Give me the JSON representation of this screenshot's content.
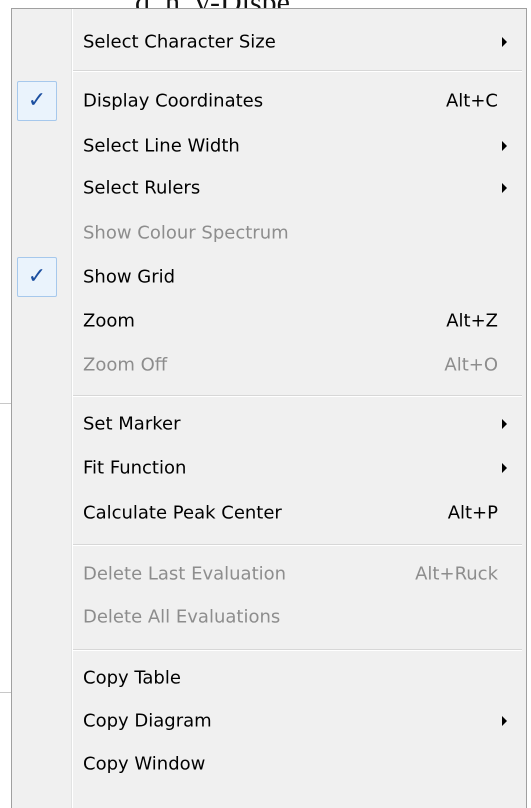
{
  "background_text": ", d. h. y-Dispe",
  "menu": {
    "items": [
      {
        "label": "Select Character Size",
        "shortcut": "",
        "submenu": true,
        "checked": false,
        "disabled": false
      },
      {
        "label": "Display Coordinates",
        "shortcut": "Alt+C",
        "submenu": false,
        "checked": true,
        "disabled": false
      },
      {
        "label": "Select Line Width",
        "shortcut": "",
        "submenu": true,
        "checked": false,
        "disabled": false
      },
      {
        "label": "Select Rulers",
        "shortcut": "",
        "submenu": true,
        "checked": false,
        "disabled": false
      },
      {
        "label": "Show Colour Spectrum",
        "shortcut": "",
        "submenu": false,
        "checked": false,
        "disabled": true
      },
      {
        "label": "Show Grid",
        "shortcut": "",
        "submenu": false,
        "checked": true,
        "disabled": false
      },
      {
        "label": "Zoom",
        "shortcut": "Alt+Z",
        "submenu": false,
        "checked": false,
        "disabled": false
      },
      {
        "label": "Zoom Off",
        "shortcut": "Alt+O",
        "submenu": false,
        "checked": false,
        "disabled": true
      },
      {
        "label": "Set Marker",
        "shortcut": "",
        "submenu": true,
        "checked": false,
        "disabled": false
      },
      {
        "label": "Fit Function",
        "shortcut": "",
        "submenu": true,
        "checked": false,
        "disabled": false
      },
      {
        "label": "Calculate Peak Center",
        "shortcut": "Alt+P",
        "submenu": false,
        "checked": false,
        "disabled": false
      },
      {
        "label": "Delete Last Evaluation",
        "shortcut": "Alt+Ruck",
        "submenu": false,
        "checked": false,
        "disabled": true
      },
      {
        "label": "Delete All Evaluations",
        "shortcut": "",
        "submenu": false,
        "checked": false,
        "disabled": true
      },
      {
        "label": "Copy Table",
        "shortcut": "",
        "submenu": false,
        "checked": false,
        "disabled": false
      },
      {
        "label": "Copy Diagram",
        "shortcut": "",
        "submenu": true,
        "checked": false,
        "disabled": false
      },
      {
        "label": "Copy Window",
        "shortcut": "",
        "submenu": false,
        "checked": false,
        "disabled": false
      }
    ],
    "check_glyph": "✓",
    "icons": {
      "check": "checkmark-icon",
      "submenu": "submenu-arrow-icon"
    }
  }
}
